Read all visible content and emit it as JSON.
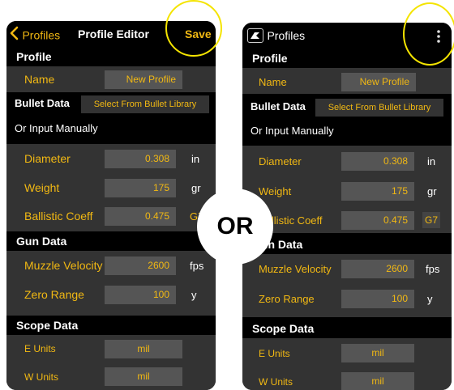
{
  "left": {
    "nav": {
      "back_label": "Profiles",
      "title": "Profile Editor",
      "save_label": "Save"
    },
    "sections": {
      "profile": "Profile",
      "gun": "Gun Data",
      "scope": "Scope Data"
    },
    "name_label": "Name",
    "name_value": "New Profile",
    "bullet_data": "Bullet Data",
    "bullet_library": "Select From Bullet Library",
    "or_manual": "Or Input Manually",
    "diameter": {
      "label": "Diameter",
      "value": "0.308",
      "unit": "in"
    },
    "weight": {
      "label": "Weight",
      "value": "175",
      "unit": "gr"
    },
    "bc": {
      "label": "Ballistic Coeff",
      "value": "0.475",
      "unit": "G7"
    },
    "mv": {
      "label": "Muzzle Velocity",
      "value": "2600",
      "unit": "fps"
    },
    "zero": {
      "label": "Zero Range",
      "value": "100",
      "unit": "y"
    },
    "e_units": {
      "label": "E Units",
      "value": "mil"
    },
    "w_units": {
      "label": "W Units",
      "value": "mil"
    }
  },
  "right": {
    "nav": {
      "title": "Profiles",
      "menu_icon": "vertical-ellipsis-icon"
    },
    "sections": {
      "profile": "Profile",
      "gun": "Gun Data",
      "scope": "Scope Data"
    },
    "name_label": "Name",
    "name_value": "New Profile",
    "bullet_data": "Bullet Data",
    "bullet_library": "Select From Bullet Library",
    "or_manual": "Or Input Manually",
    "diameter": {
      "label": "Diameter",
      "value": "0.308",
      "unit": "in"
    },
    "weight": {
      "label": "Weight",
      "value": "175",
      "unit": "gr"
    },
    "bc": {
      "label": "Ballistic Coeff",
      "value": "0.475",
      "unit": "G7"
    },
    "mv": {
      "label": "Muzzle Velocity",
      "value": "2600",
      "unit": "fps"
    },
    "zero": {
      "label": "Zero Range",
      "value": "100",
      "unit": "y"
    },
    "e_units": {
      "label": "E Units",
      "value": "mil"
    },
    "w_units": {
      "label": "W Units",
      "value": "mil"
    }
  },
  "or_text": "OR",
  "colors": {
    "accent": "#f1b813",
    "band": "#333333",
    "field": "#555555",
    "highlight": "#f4e400"
  }
}
